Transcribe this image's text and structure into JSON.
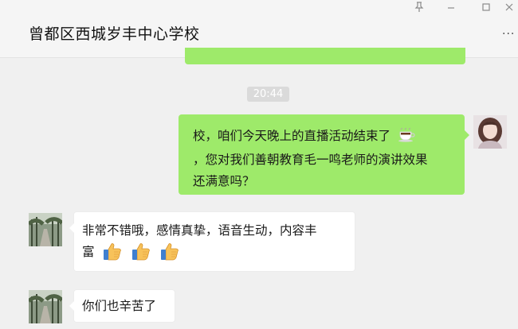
{
  "chat": {
    "title": "曾都区西城岁丰中心学校",
    "more_label": "···",
    "window_controls": {
      "pin_icon": "pin-icon",
      "minimize_icon": "minimize-icon",
      "maximize_icon": "maximize-icon",
      "close_icon": "close-icon"
    }
  },
  "messages": {
    "time_stamp": "20:44",
    "outgoing": {
      "line1": "校，咱们今天晚上的直播活动结束了",
      "line2": "，您对我们善朝教育毛一鸣老师的演讲效果",
      "line3": "还满意吗？",
      "emoji": "coffee-icon"
    },
    "incoming1": {
      "line1": "非常不错哦，感情真挚，语音生动，内容丰",
      "line2": "富",
      "emojis": [
        "thumbs-up-icon",
        "thumbs-up-icon",
        "thumbs-up-icon"
      ]
    },
    "incoming2": {
      "text": "你们也辛苦了"
    }
  },
  "colors": {
    "self_bubble": "#9eea6a",
    "other_bubble": "#ffffff",
    "background": "#f0f0f0"
  }
}
